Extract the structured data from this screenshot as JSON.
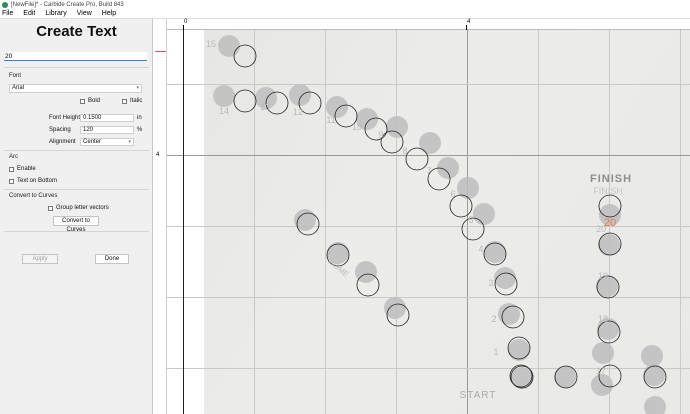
{
  "window": {
    "title": "[NewFile]* - Carbide Create Pro, Build 843"
  },
  "menu": [
    "File",
    "Edit",
    "Library",
    "View",
    "Help"
  ],
  "panel": {
    "title": "Create Text",
    "text_value": "20",
    "font_section": "Font",
    "font_value": "Arial",
    "bold_label": "Bold",
    "italic_label": "Italic",
    "font_height_label": "Font Height",
    "font_height_value": "0.1500",
    "font_height_unit": "in",
    "spacing_label": "Spacing",
    "spacing_value": "120",
    "spacing_unit": "%",
    "alignment_label": "Alignment",
    "alignment_value": "Center",
    "arc_section": "Arc",
    "enable_label": "Enable",
    "text_bottom_label": "Text on Bottom",
    "convert_section": "Convert to Curves",
    "group_vectors_label": "Group letter vectors",
    "convert_button": "Convert to Curves",
    "apply_button": "Apply",
    "done_button": "Done"
  },
  "ruler": {
    "top_marks": [
      "0",
      "4"
    ],
    "left_marks": [
      "4"
    ]
  },
  "board": {
    "finish_label": "FINISH",
    "finish_faded": "FINISH",
    "start_label": "START",
    "home_label": "HOME",
    "selected_number": "20",
    "numbers": [
      "15",
      "14",
      "13",
      "12",
      "11",
      "10",
      "9",
      "8",
      "7",
      "6",
      "5",
      "4",
      "3",
      "2",
      "1",
      "20",
      "19",
      "18",
      "17"
    ],
    "colors": {
      "selected": "#e8774a",
      "hole_fill": "#bdbdbd",
      "photo_bg": "#e8e8e6"
    }
  }
}
